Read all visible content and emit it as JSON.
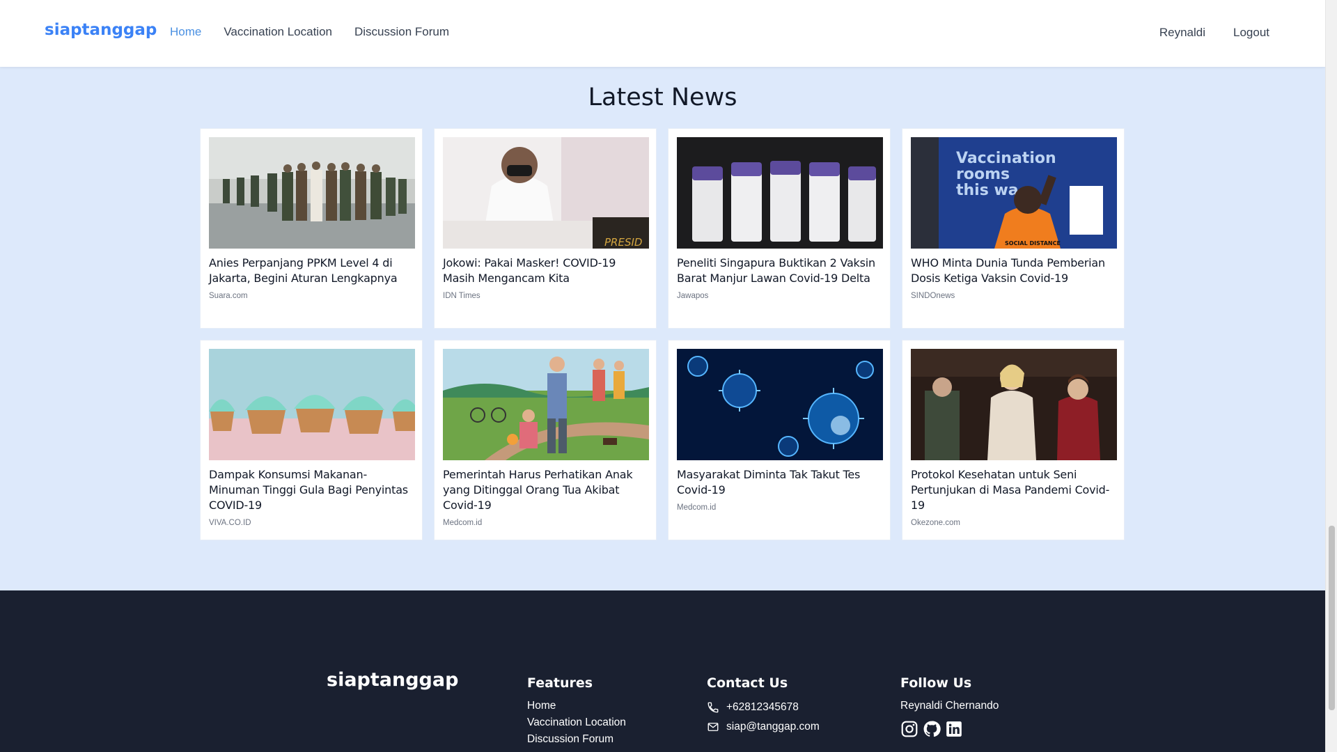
{
  "nav": {
    "brand": "siaptanggap",
    "links": [
      "Home",
      "Vaccination Location",
      "Discussion Forum"
    ],
    "active": "Home",
    "user": "Reynaldi",
    "logout": "Logout"
  },
  "news": {
    "title": "Latest News",
    "items": [
      {
        "title": "Anies Perpanjang PPKM Level 4 di Jakarta, Begini Aturan Lengkapnya",
        "source": "Suara.com"
      },
      {
        "title": "Jokowi: Pakai Masker! COVID-19 Masih Mengancam Kita",
        "source": "IDN Times"
      },
      {
        "title": "Peneliti Singapura Buktikan 2 Vaksin Barat Manjur Lawan Covid-19 Delta",
        "source": "Jawapos"
      },
      {
        "title": "WHO Minta Dunia Tunda Pemberian Dosis Ketiga Vaksin Covid-19",
        "source": "SINDOnews"
      },
      {
        "title": "Dampak Konsumsi Makanan-Minuman Tinggi Gula Bagi Penyintas COVID-19",
        "source": "VIVA.CO.ID"
      },
      {
        "title": "Pemerintah Harus Perhatikan Anak yang Ditinggal Orang Tua Akibat Covid-19",
        "source": "Medcom.id"
      },
      {
        "title": "Masyarakat Diminta Tak Takut Tes Covid-19",
        "source": "Medcom.id"
      },
      {
        "title": "Protokol Kesehatan untuk Seni Pertunjukan di Masa Pandemi Covid-19",
        "source": "Okezone.com"
      }
    ],
    "image_texts": {
      "jokowi": "PRESID",
      "who_sign": [
        "Vaccination",
        "rooms",
        "this wa"
      ],
      "who_vest": "SOCIAL DISTANCE"
    }
  },
  "footer": {
    "brand": "siaptanggap",
    "features": {
      "heading": "Features",
      "links": [
        "Home",
        "Vaccination Location",
        "Discussion Forum"
      ]
    },
    "contact": {
      "heading": "Contact Us",
      "phone": "+62812345678",
      "email": "siap@tanggap.com"
    },
    "follow": {
      "heading": "Follow Us",
      "name": "Reynaldi Chernando"
    }
  },
  "colors": {
    "brand": "#3b82f6",
    "page_bg": "#dde9fb",
    "footer_bg": "#1a2030"
  }
}
